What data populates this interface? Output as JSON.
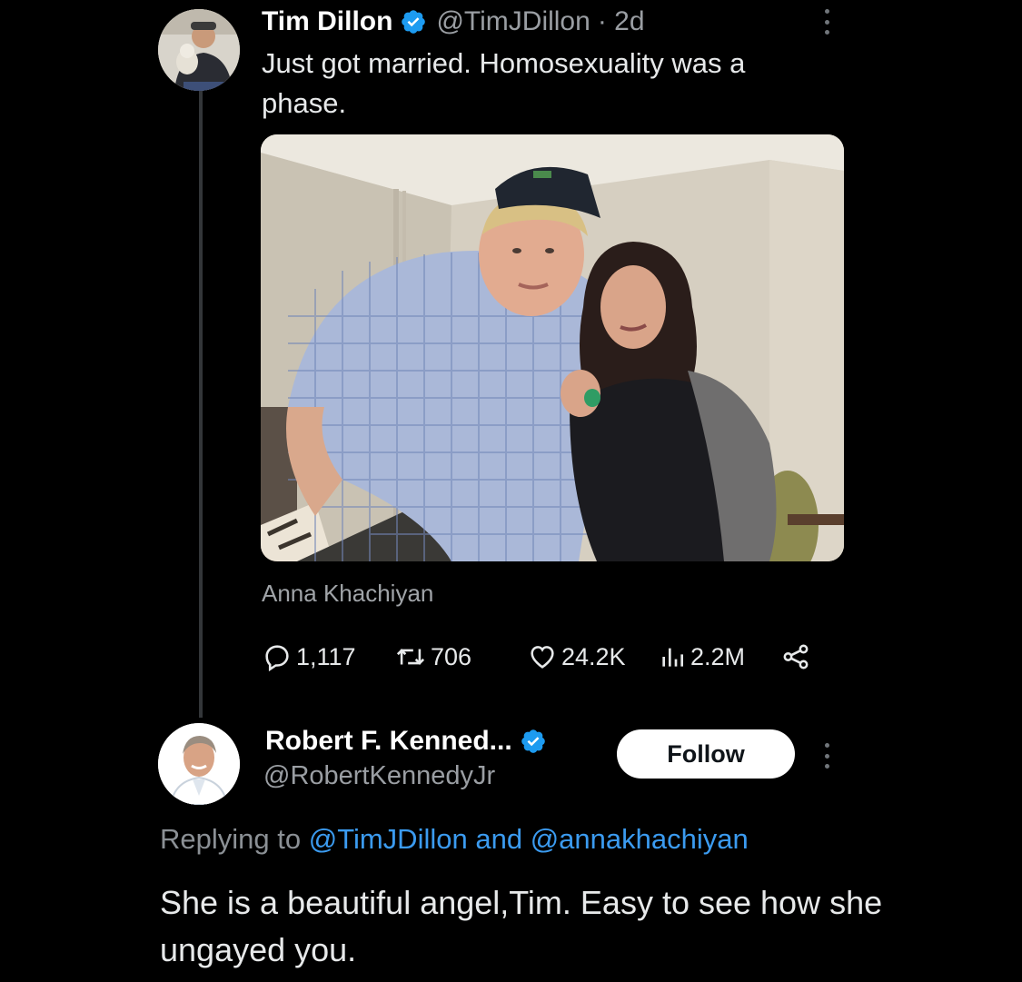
{
  "tweet": {
    "display_name": "Tim Dillon",
    "handle": "@TimJDillon",
    "age": "· 2d",
    "text": "Just got married. Homosexuality was a phase.",
    "tagged_user": "Anna Khachiyan",
    "avatar_icon": "user-avatar-photo",
    "photo_icon": "couple-photo",
    "verified_icon": "verified-badge-icon",
    "more_icon": "more-options-icon",
    "stats": {
      "replies": "1,117",
      "retweets": "706",
      "likes": "24.2K",
      "views": "2.2M"
    },
    "action_icons": [
      "reply-icon",
      "retweet-icon",
      "like-icon",
      "views-icon",
      "share-icon"
    ]
  },
  "reply": {
    "display_name": "Robert F. Kenned...",
    "handle": "@RobertKennedyJr",
    "follow_label": "Follow",
    "replying_prefix": "Replying to",
    "mention_1": "@TimJDillon",
    "replying_and": "and",
    "mention_2": "@annakhachiyan",
    "text": "She is a beautiful angel,Tim. Easy to see how she ungayed you."
  },
  "colors": {
    "background": "#000000",
    "text_primary": "#e7e9ea",
    "text_secondary": "#9a9ea3",
    "link": "#3b9bf0",
    "verified": "#1d9bf0",
    "follow_bg": "#ffffff"
  }
}
